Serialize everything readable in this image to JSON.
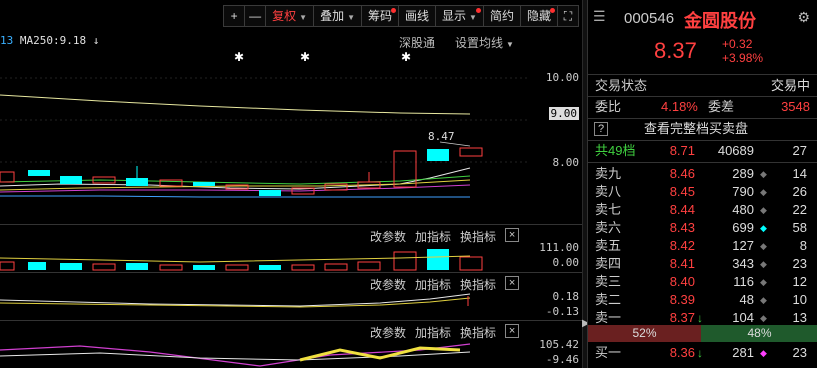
{
  "toolbar": {
    "plus": "+",
    "minus": "—",
    "fuquan": "复权",
    "diejia": "叠加",
    "chouma": "筹码",
    "huaxian": "画线",
    "xianshi": "显示",
    "jianyue": "简约",
    "yincang": "隐藏",
    "fullscreen": "⛶"
  },
  "ma_text": {
    "prefix": "13",
    "ma250": "MA250:9.18",
    "arrow": "↓"
  },
  "shenzhentong": "深股通",
  "set_ma": "设置均线",
  "price_axis": {
    "p10": "10.00",
    "p9": "9.00",
    "p8": "8.00"
  },
  "high_label": "8.47",
  "sub1": {
    "change_params": "改参数",
    "add_indicator": "加指标",
    "switch_indicator": "换指标",
    "close": "×",
    "v1": "111.00",
    "v2": "0.00"
  },
  "sub2": {
    "change_params": "改参数",
    "add_indicator": "加指标",
    "switch_indicator": "换指标",
    "close": "×",
    "v1": "0.18",
    "v2": "-0.13"
  },
  "sub3": {
    "change_params": "改参数",
    "add_indicator": "加指标",
    "switch_indicator": "换指标",
    "close": "×",
    "v1": "105.42",
    "v2": "-9.46"
  },
  "stock": {
    "code": "000546",
    "name": "金圆股份",
    "price": "8.37",
    "change": "+0.32",
    "change_pct": "+3.98%"
  },
  "status": {
    "label": "交易状态",
    "value": "交易中"
  },
  "weibi": {
    "label": "委比",
    "value": "4.18%",
    "label2": "委差",
    "value2": "3548"
  },
  "full_book": {
    "q": "?",
    "label": "查看完整档买卖盘"
  },
  "total_row": {
    "label": "共49档",
    "price": "8.71",
    "vol": "40689",
    "orders": "27"
  },
  "sells": [
    {
      "label": "卖九",
      "price": "8.46",
      "vol": "289",
      "mark": "◆",
      "orders": "14"
    },
    {
      "label": "卖八",
      "price": "8.45",
      "vol": "790",
      "mark": "◆",
      "orders": "26"
    },
    {
      "label": "卖七",
      "price": "8.44",
      "vol": "480",
      "mark": "◆",
      "orders": "22"
    },
    {
      "label": "卖六",
      "price": "8.43",
      "vol": "699",
      "mark": "◆",
      "orders": "58"
    },
    {
      "label": "卖五",
      "price": "8.42",
      "vol": "127",
      "mark": "◆",
      "orders": "8"
    },
    {
      "label": "卖四",
      "price": "8.41",
      "vol": "343",
      "mark": "◆",
      "orders": "23"
    },
    {
      "label": "卖三",
      "price": "8.40",
      "vol": "116",
      "mark": "◆",
      "orders": "12"
    },
    {
      "label": "卖二",
      "price": "8.39",
      "vol": "48",
      "mark": "◆",
      "orders": "10"
    },
    {
      "label": "卖一",
      "price": "8.37",
      "vol": "104",
      "mark": "◆",
      "orders": "13"
    }
  ],
  "ratio": {
    "sell": "52%",
    "buy": "48%"
  },
  "buys": [
    {
      "label": "买一",
      "price": "8.36",
      "vol": "281",
      "mark": "◆",
      "orders": "23"
    }
  ],
  "colors": {
    "up": "#ff4040",
    "down": "#00ffff",
    "bg": "#000000"
  }
}
